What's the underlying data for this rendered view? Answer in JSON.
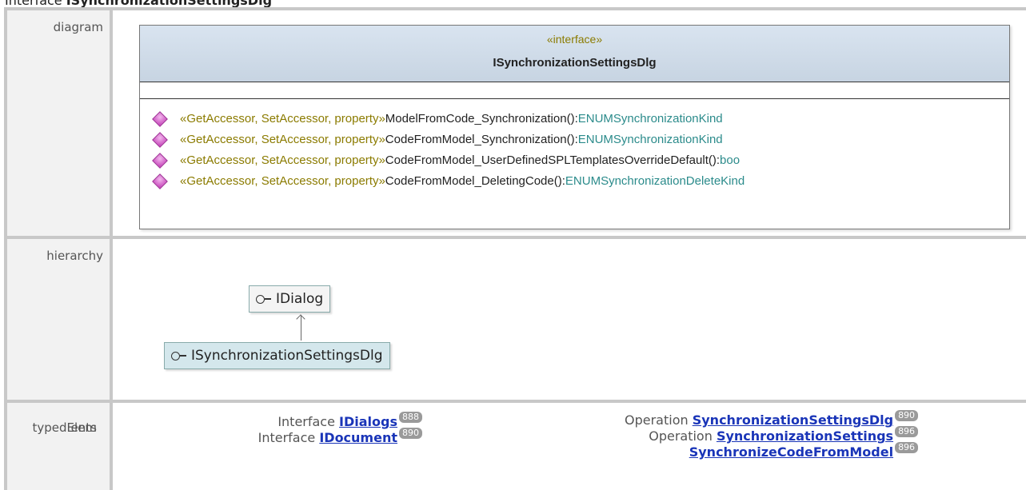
{
  "heading": {
    "prefix": "Interface ",
    "name": "ISynchronizationSettingsDlg"
  },
  "rows": {
    "diagram": {
      "label": "diagram"
    },
    "hierarchy": {
      "label": "hierarchy"
    },
    "typed": {
      "label_line1": "typedElem",
      "label_line2": "ents"
    }
  },
  "uml": {
    "stereotype": "«interface»",
    "name": "ISynchronizationSettingsDlg",
    "operations": [
      {
        "stereo": "«GetAccessor, SetAccessor, property»",
        "name": " ModelFromCode_Synchronization():",
        "type": "ENUMSynchronizationKind"
      },
      {
        "stereo": "«GetAccessor, SetAccessor, property»",
        "name": " CodeFromModel_Synchronization():",
        "type": "ENUMSynchronizationKind"
      },
      {
        "stereo": "«GetAccessor, SetAccessor, property»",
        "name": " CodeFromModel_UserDefinedSPLTemplatesOverrideDefault():",
        "type": "boo"
      },
      {
        "stereo": "«GetAccessor, SetAccessor, property»",
        "name": " CodeFromModel_DeletingCode():",
        "type": "ENUMSynchronizationDeleteKind"
      }
    ]
  },
  "hierarchy": {
    "parent": "IDialog",
    "child": "ISynchronizationSettingsDlg"
  },
  "typed_elements": {
    "left": [
      {
        "kind": "Interface ",
        "link": "IDialogs",
        "badge": "888"
      },
      {
        "kind": "Interface ",
        "link": "IDocument",
        "badge": "890"
      }
    ],
    "right": [
      {
        "kind": "Operation ",
        "link": "SynchronizationSettingsDlg",
        "badge": "890"
      },
      {
        "kind": "Operation ",
        "link": "SynchronizationSettings",
        "badge": "896"
      },
      {
        "kind": "",
        "link": "SynchronizeCodeFromModel",
        "badge": "896"
      }
    ]
  },
  "colors": {
    "link": "#1a35b8",
    "stereotype": "#8b7b00",
    "type": "#2b8b8b",
    "operation_icon": "#c23bb5"
  }
}
